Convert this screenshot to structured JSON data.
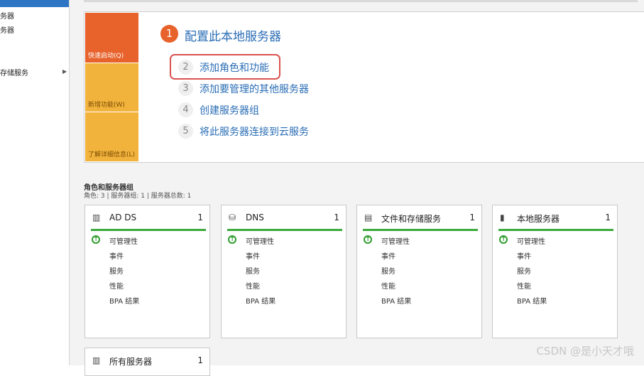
{
  "nav": {
    "items": [
      "务器",
      "务器",
      "存储服务"
    ]
  },
  "quickstart": {
    "tiles": [
      "快速启动(Q)",
      "新增功能(W)",
      "了解详细信息(L)"
    ],
    "step1": {
      "num": "1",
      "label": "配置此本地服务器"
    },
    "steps": [
      {
        "num": "2",
        "label": "添加角色和功能"
      },
      {
        "num": "3",
        "label": "添加要管理的其他服务器"
      },
      {
        "num": "4",
        "label": "创建服务器组"
      },
      {
        "num": "5",
        "label": "将此服务器连接到云服务"
      }
    ]
  },
  "roles": {
    "title": "角色和服务器组",
    "subtitle": "角色: 3 | 服务器组: 1 | 服务器总数: 1",
    "cards": [
      {
        "title": "AD DS",
        "count": "1",
        "icon": "ad-ds-icon",
        "rows": [
          "可管理性",
          "事件",
          "服务",
          "性能",
          "BPA 结果"
        ]
      },
      {
        "title": "DNS",
        "count": "1",
        "icon": "dns-icon",
        "rows": [
          "可管理性",
          "事件",
          "服务",
          "性能",
          "BPA 结果"
        ]
      },
      {
        "title": "文件和存储服务",
        "count": "1",
        "icon": "file-storage-icon",
        "rows": [
          "可管理性",
          "事件",
          "服务",
          "性能",
          "BPA 结果"
        ]
      },
      {
        "title": "本地服务器",
        "count": "1",
        "icon": "server-icon",
        "rows": [
          "可管理性",
          "事件",
          "服务",
          "性能",
          "BPA 结果"
        ]
      },
      {
        "title": "所有服务器",
        "count": "1",
        "icon": "all-servers-icon",
        "rows": []
      }
    ]
  },
  "watermark": "CSDN @是小天才哦",
  "colors": {
    "accent": "#e8622b",
    "tile_yellow": "#f2b33d",
    "link": "#2a6db5",
    "ok": "#3caa3c",
    "highlight": "#d9534f"
  }
}
